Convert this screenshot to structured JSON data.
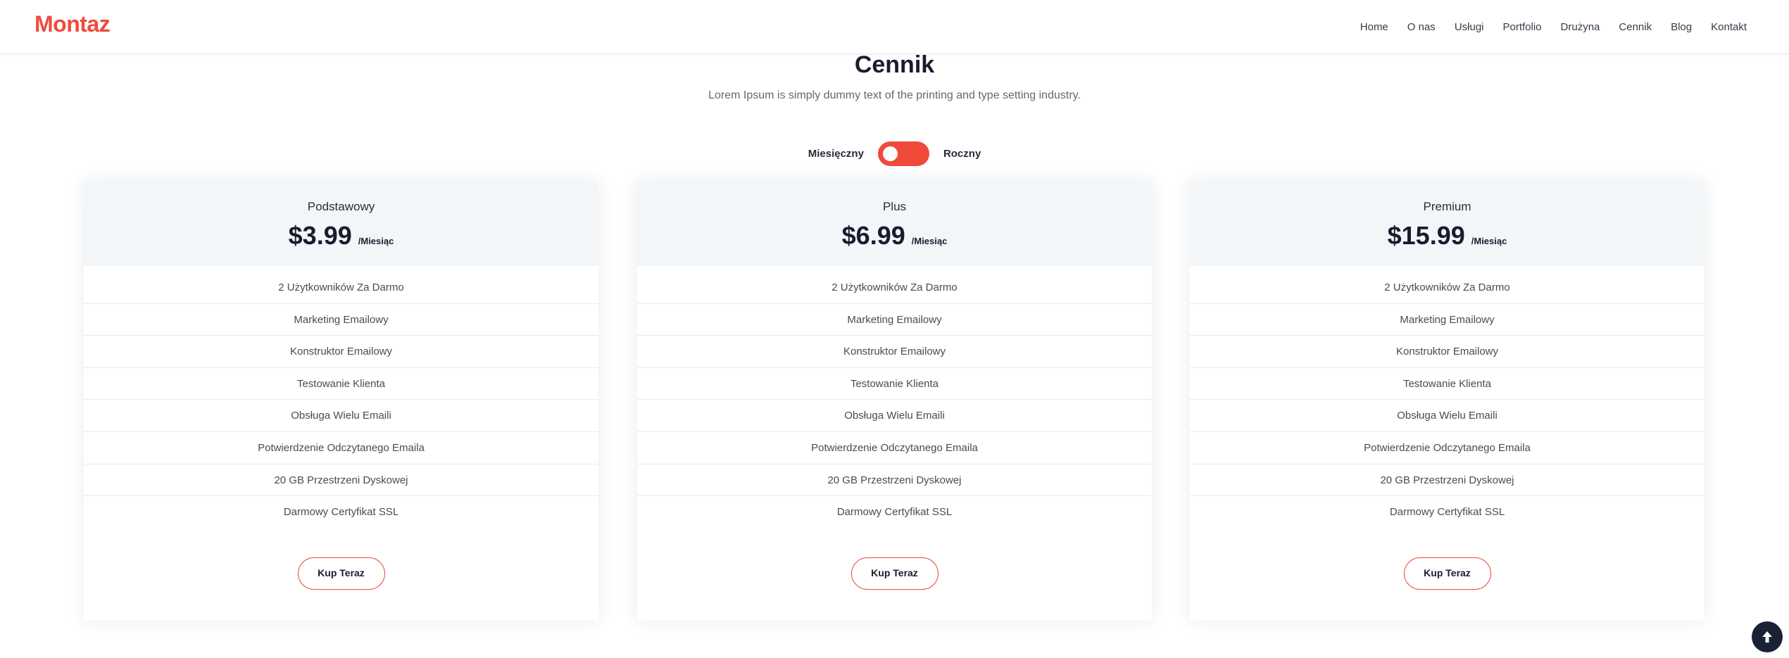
{
  "brand": {
    "logo": "Montaz",
    "accent_color": "#f04a3b"
  },
  "nav": {
    "items": [
      "Home",
      "O nas",
      "Usługi",
      "Portfolio",
      "Drużyna",
      "Cennik",
      "Blog",
      "Kontakt"
    ]
  },
  "pricing": {
    "title": "Cennik",
    "subtitle": "Lorem Ipsum is simply dummy text of the printing and type setting industry.",
    "toggle": {
      "left_label": "Miesięczny",
      "right_label": "Roczny",
      "state": "monthly"
    },
    "plans": [
      {
        "name": "Podstawowy",
        "price": "$3.99",
        "period": "/Miesiąc",
        "features": [
          "2 Użytkowników Za Darmo",
          "Marketing Emailowy",
          "Konstruktor Emailowy",
          "Testowanie Klienta",
          "Obsługa Wielu Emaili",
          "Potwierdzenie Odczytanego Emaila",
          "20 GB Przestrzeni Dyskowej",
          "Darmowy Certyfikat SSL"
        ],
        "button": "Kup Teraz"
      },
      {
        "name": "Plus",
        "price": "$6.99",
        "period": "/Miesiąc",
        "features": [
          "2 Użytkowników Za Darmo",
          "Marketing Emailowy",
          "Konstruktor Emailowy",
          "Testowanie Klienta",
          "Obsługa Wielu Emaili",
          "Potwierdzenie Odczytanego Emaila",
          "20 GB Przestrzeni Dyskowej",
          "Darmowy Certyfikat SSL"
        ],
        "button": "Kup Teraz"
      },
      {
        "name": "Premium",
        "price": "$15.99",
        "period": "/Miesiąc",
        "features": [
          "2 Użytkowników Za Darmo",
          "Marketing Emailowy",
          "Konstruktor Emailowy",
          "Testowanie Klienta",
          "Obsługa Wielu Emaili",
          "Potwierdzenie Odczytanego Emaila",
          "20 GB Przestrzeni Dyskowej",
          "Darmowy Certyfikat SSL"
        ],
        "button": "Kup Teraz"
      }
    ]
  },
  "scroll_top": {
    "icon": "arrow-up-icon"
  }
}
